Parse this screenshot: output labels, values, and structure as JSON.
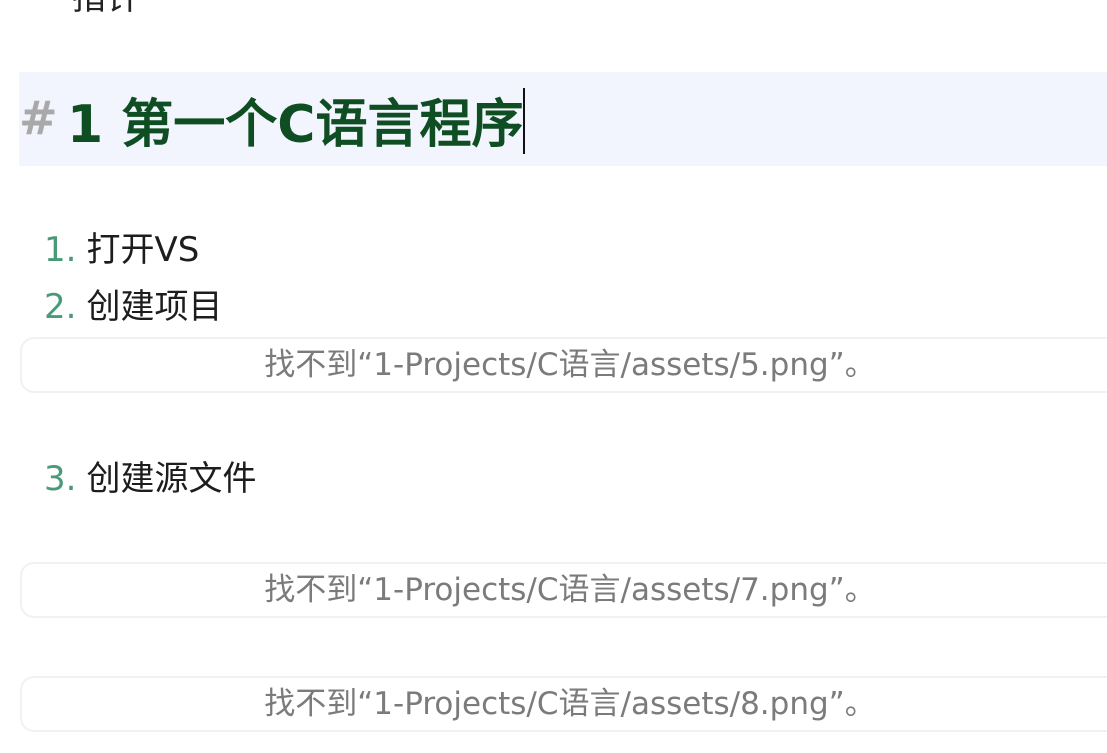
{
  "editor": {
    "previous_line_text": "指针",
    "heading": {
      "marker": "#",
      "text": "1 第一个C语言程序",
      "accent_color": "#0f4d22",
      "background": "#f3f5fe"
    },
    "list": [
      {
        "number": "1.",
        "label": "打开VS"
      },
      {
        "number": "2.",
        "label": "创建项目"
      },
      {
        "number": "3.",
        "label": "创建源文件"
      }
    ],
    "missing_embeds": [
      {
        "message": "找不到“1-Projects/C语言/assets/5.png”。"
      },
      {
        "message": "找不到“1-Projects/C语言/assets/7.png”。"
      },
      {
        "message": "找不到“1-Projects/C语言/assets/8.png”。"
      }
    ],
    "list_number_color": "#4a9a78"
  }
}
